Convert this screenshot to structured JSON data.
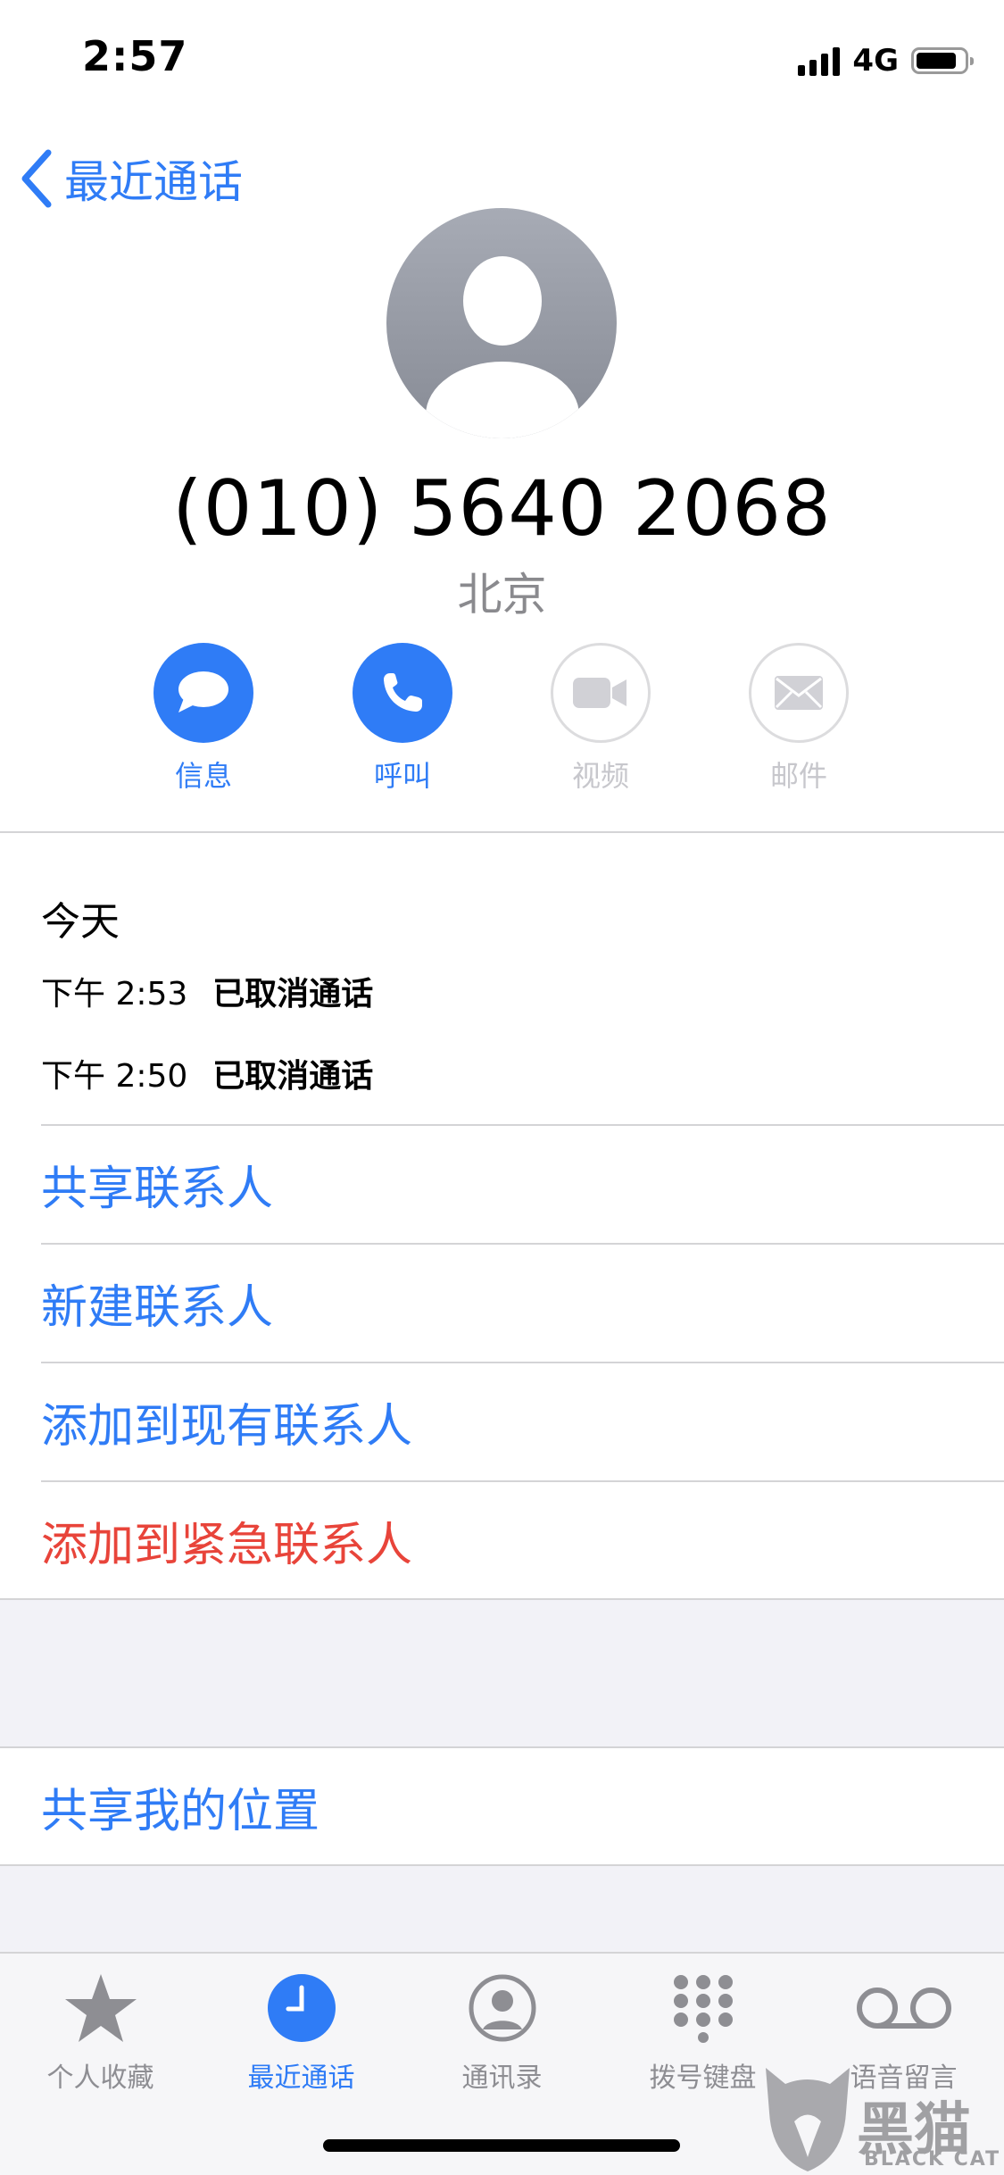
{
  "status_bar": {
    "time": "2:57",
    "network": "4G",
    "battery_level": 0.85
  },
  "nav": {
    "back_label": "最近通话"
  },
  "contact": {
    "phone_number": "(010) 5640 2068",
    "location": "北京"
  },
  "actions": [
    {
      "label": "信息",
      "icon": "message-icon",
      "enabled": true
    },
    {
      "label": "呼叫",
      "icon": "phone-icon",
      "enabled": true
    },
    {
      "label": "视频",
      "icon": "video-icon",
      "enabled": false
    },
    {
      "label": "邮件",
      "icon": "mail-icon",
      "enabled": false
    }
  ],
  "history": {
    "title": "今天",
    "calls": [
      {
        "time": "下午 2:53",
        "status": "已取消通话"
      },
      {
        "time": "下午 2:50",
        "status": "已取消通话"
      }
    ]
  },
  "options": {
    "share_contact": "共享联系人",
    "new_contact": "新建联系人",
    "add_existing": "添加到现有联系人",
    "add_emergency": "添加到紧急联系人",
    "share_location": "共享我的位置"
  },
  "tabs": [
    {
      "label": "个人收藏",
      "icon": "star-icon",
      "active": false
    },
    {
      "label": "最近通话",
      "icon": "clock-icon",
      "active": true
    },
    {
      "label": "通讯录",
      "icon": "contacts-icon",
      "active": false
    },
    {
      "label": "拨号键盘",
      "icon": "keypad-icon",
      "active": false
    },
    {
      "label": "语音留言",
      "icon": "voicemail-icon",
      "active": false
    }
  ],
  "watermark": {
    "text": "黑猫",
    "subtext": "BLACK CAT"
  },
  "colors": {
    "accent": "#2f7cf6",
    "danger": "#e8443a",
    "secondary_text": "#8a8a8e",
    "disabled": "#c7c7cc"
  }
}
